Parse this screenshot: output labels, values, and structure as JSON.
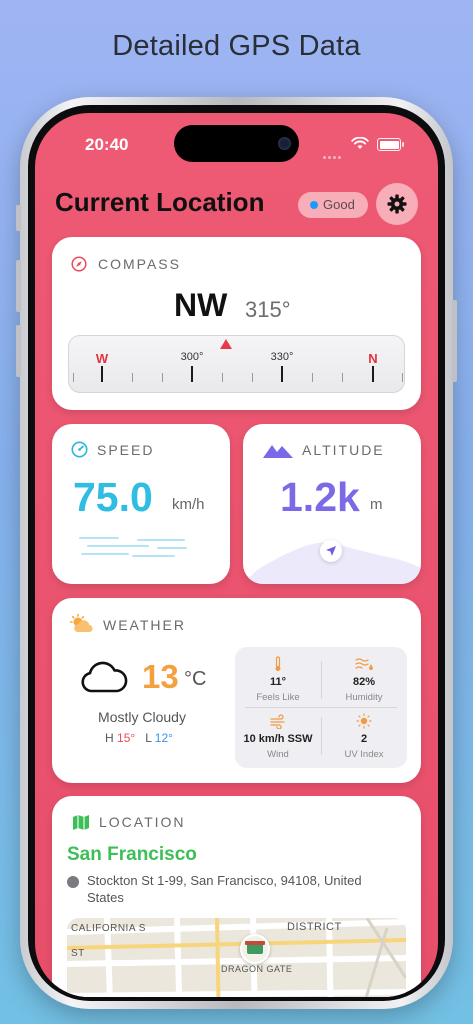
{
  "headline": "Detailed GPS Data",
  "status": {
    "time": "20:40"
  },
  "header": {
    "title": "Current Location",
    "badge": "Good"
  },
  "compass": {
    "label": "COMPASS",
    "direction": "NW",
    "degrees": "315°",
    "scale": {
      "west": "W",
      "d300": "300°",
      "d330": "330°",
      "north": "N"
    }
  },
  "speed": {
    "label": "SPEED",
    "value": "75.0",
    "unit": "km/h"
  },
  "altitude": {
    "label": "ALTITUDE",
    "value": "1.2k",
    "unit": "m"
  },
  "weather": {
    "label": "WEATHER",
    "temp": "13",
    "temp_unit": "°C",
    "condition": "Mostly Cloudy",
    "hi_label": "H",
    "hi": "15°",
    "lo_label": "L",
    "lo": "12°",
    "feels_like": {
      "value": "11°",
      "label": "Feels Like"
    },
    "humidity": {
      "value": "82%",
      "label": "Humidity"
    },
    "wind": {
      "value": "10 km/h SSW",
      "label": "Wind"
    },
    "uv": {
      "value": "2",
      "label": "UV Index"
    }
  },
  "location": {
    "label": "LOCATION",
    "city": "San Francisco",
    "address": "Stockton St 1-99, San Francisco, 94108, United States",
    "map_labels": {
      "street": "CALIFORNIA S",
      "district": "DISTRICT",
      "st": "ST",
      "gate": "DRAGON GATE"
    }
  },
  "colors": {
    "screen_bg": "#ee5a74",
    "speed": "#2fbde3",
    "altitude": "#7b6ae8",
    "temp": "#f5a040",
    "city": "#3cbf57",
    "badge_dot": "#1a9bff"
  }
}
